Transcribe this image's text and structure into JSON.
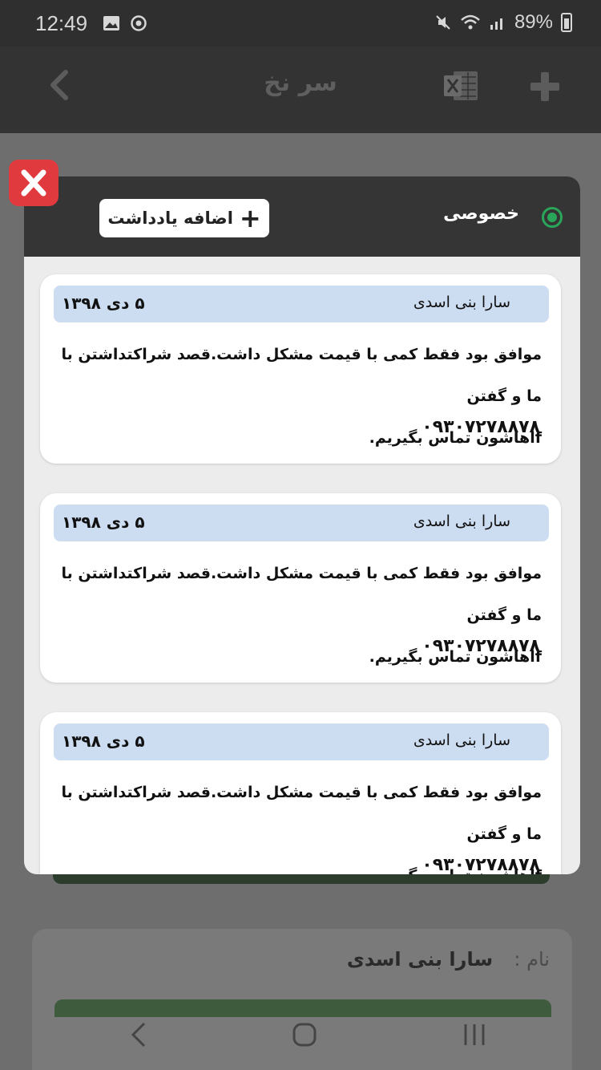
{
  "status_bar": {
    "time": "12:49",
    "battery": "89%",
    "icons": [
      "image-icon",
      "sync-icon",
      "mute-icon",
      "wifi-icon",
      "signal-icon",
      "battery-icon"
    ]
  },
  "app_bar": {
    "title": "سر نخ",
    "icons": [
      "back-chevron-icon",
      "excel-icon",
      "add-icon"
    ]
  },
  "background": {
    "name_label": "نام :",
    "name_value": "سارا بنی اسدی"
  },
  "modal": {
    "tab_label": "خصوصی",
    "add_note_label": "اضافه یادداشت",
    "add_note_icon": "plus-icon",
    "close_icon": "close-icon",
    "close_color": "#e03a3e",
    "accent_color": "#2aa65a",
    "notes": [
      {
        "author": "سارا بنی اسدی",
        "date": "۵ دی ۱۳۹۸",
        "line1": "موافق بود فقط کمی با قیمت مشکل داشت.قصد شراکتداشتن با ما و گفتن",
        "line2": "fاهاشون تماس بگیریم.",
        "phone": "۰۹۳۰۷۲۷۸۸۷۸"
      },
      {
        "author": "سارا بنی اسدی",
        "date": "۵ دی ۱۳۹۸",
        "line1": "موافق بود فقط کمی با قیمت مشکل داشت.قصد شراکتداشتن با ما و گفتن",
        "line2": "fاهاشون تماس بگیریم.",
        "phone": "۰۹۳۰۷۲۷۸۸۷۸"
      },
      {
        "author": "سارا بنی اسدی",
        "date": "۵ دی ۱۳۹۸",
        "line1": "موافق بود فقط کمی با قیمت مشکل داشت.قصد شراکتداشتن با ما و گفتن",
        "line2": "fاهاشون تماس بگیریم.",
        "phone": "۰۹۳۰۷۲۷۸۸۷۸"
      }
    ]
  },
  "nav_bar": {
    "icons": [
      "nav-back-icon",
      "nav-home-icon",
      "nav-recents-icon"
    ]
  }
}
